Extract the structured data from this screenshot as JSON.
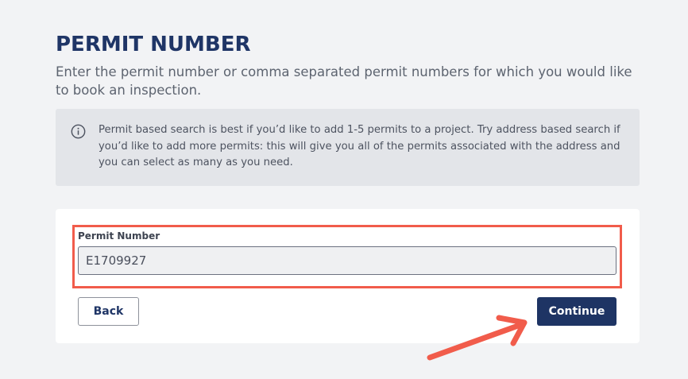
{
  "header": {
    "title": "PERMIT NUMBER",
    "subtitle": "Enter the permit number or comma separated permit numbers for which you would like to book an inspection."
  },
  "info": {
    "icon": "info-circle-icon",
    "text": "Permit based search is best if you’d like to add 1-5 permits to a project. Try address based search if you’d like to add more permits: this will give you all of the permits associated with the address and you can select as many as you need."
  },
  "form": {
    "permit_label": "Permit Number",
    "permit_value": "E1709927",
    "back_label": "Back",
    "continue_label": "Continue"
  },
  "annotation": {
    "highlight_color": "#f15c4b",
    "arrow_icon": "arrow-pointer-icon"
  },
  "colors": {
    "primary": "#1e3464",
    "background": "#f2f3f5",
    "info_background": "#e3e5e9"
  }
}
